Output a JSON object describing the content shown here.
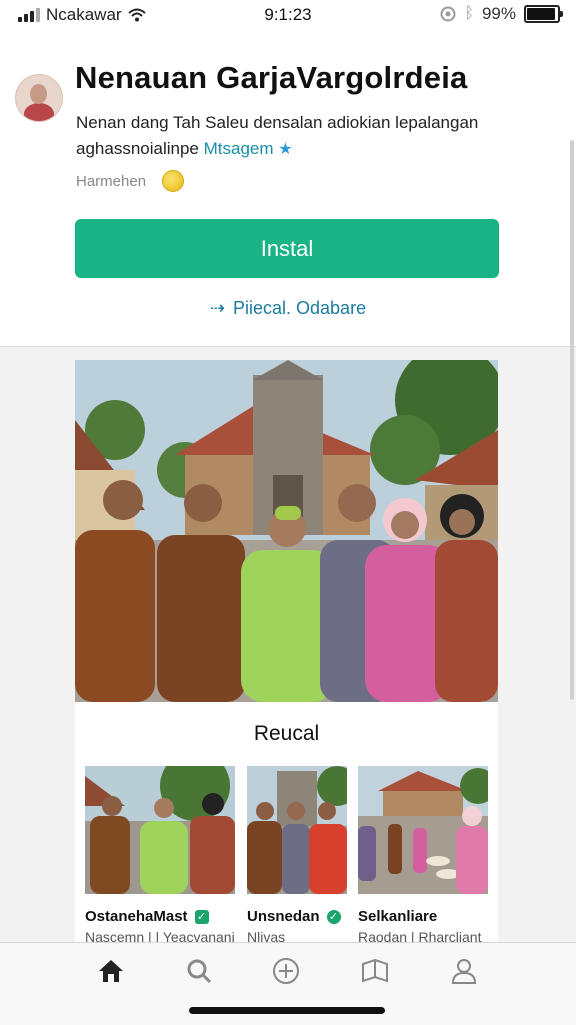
{
  "status_bar": {
    "carrier": "Ncakawar",
    "time": "9:1:23",
    "battery": "99%"
  },
  "app": {
    "title": "Nenauan GarjaVargolrdeia",
    "description": "Nenan dang Tah Saleu densalan adiokian lepalangan",
    "tag_prefix": "aghassnoialinpe ",
    "tag_accent": "Mtsagem",
    "rating_label": "Harmehen",
    "install_label": "Instal",
    "preview_label": "Piiecal. Odabare"
  },
  "related": {
    "title": "Reucal",
    "items": [
      {
        "name": "OstanehaMast",
        "subtitle": "Nascemn  |  |  Yeacvanani"
      },
      {
        "name": "Unsnedan",
        "subtitle": "Nlivas"
      },
      {
        "name": "Selkanliare",
        "subtitle": "Raodan  |  Rharcliant"
      }
    ]
  },
  "nav": {
    "items": [
      "home-icon",
      "search-icon",
      "add-icon",
      "library-icon",
      "profile-icon"
    ]
  },
  "colors": {
    "install_green": "#19b386",
    "link_blue": "#1b7aa0",
    "verified_green": "#1aa66a"
  }
}
